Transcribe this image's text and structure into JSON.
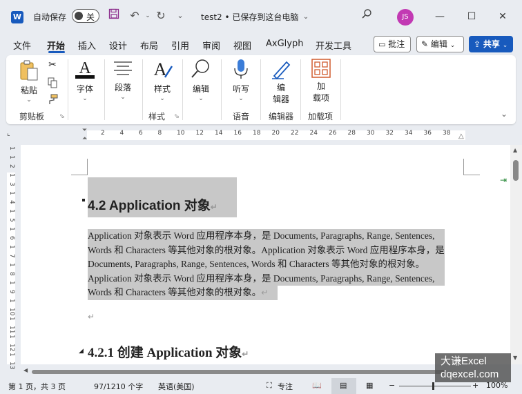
{
  "titlebar": {
    "autosave_label": "自动保存",
    "autosave_state": "关",
    "doc_title": "test2 • 已保存到这台电脑",
    "avatar_initials": "JS"
  },
  "tabs": {
    "items": [
      "文件",
      "开始",
      "插入",
      "设计",
      "布局",
      "引用",
      "审阅",
      "视图",
      "AxGlyph",
      "开发工具"
    ],
    "active": "开始",
    "comments": "批注",
    "editing": "编辑",
    "share": "共享"
  },
  "ribbon": {
    "paste": "粘贴",
    "clipboard_group": "剪贴板",
    "font": "字体",
    "paragraph": "段落",
    "styles": "样式",
    "styles_group": "样式",
    "editing": "编辑",
    "dictate": "听写",
    "voice_group": "语音",
    "editor_line1": "编",
    "editor_line2": "辑器",
    "editor_group": "编辑器",
    "addins_line1": "加",
    "addins_line2": "载项",
    "addins_group": "加载项"
  },
  "ruler": {
    "h_numbers": [
      "2",
      "4",
      "6",
      "8",
      "10",
      "12",
      "14",
      "16",
      "18",
      "20",
      "22",
      "24",
      "26",
      "28",
      "30",
      "32",
      "34",
      "36",
      "38"
    ],
    "v_numbers": [
      "1",
      "1",
      "2",
      "1",
      "3",
      "1",
      "4",
      "1",
      "5",
      "1",
      "6",
      "1",
      "7",
      "1",
      "8",
      "1",
      "9",
      "1",
      "10",
      "1",
      "11",
      "1",
      "12",
      "1",
      "13"
    ]
  },
  "document": {
    "heading1": "4.2 Application  对象",
    "para_lines": [
      "Application 对象表示 Word 应用程序本身，是 Documents, Paragraphs, Range, Sentences,",
      "Words 和 Characters 等其他对象的根对象。Application 对象表示 Word 应用程序本身，是",
      "Documents, Paragraphs, Range, Sentences, Words 和 Characters 等其他对象的根对象。",
      "Application 对象表示 Word 应用程序本身，是 Documents, Paragraphs, Range, Sentences,",
      "Words 和 Characters 等其他对象的根对象。"
    ],
    "heading2": "4.2.1  创建 Application 对象",
    "para_mark": "↵"
  },
  "status": {
    "page": "第 1 页，共 3 页",
    "words": "97/1210 个字",
    "language": "英语(美国)",
    "focus": "专注",
    "zoom": "100%"
  },
  "watermark": {
    "line1": "大谦Excel",
    "line2": "dqexcel.com"
  },
  "colors": {
    "word_blue": "#185abd",
    "selection": "#c8c8c8",
    "avatar": "#c239b3"
  }
}
